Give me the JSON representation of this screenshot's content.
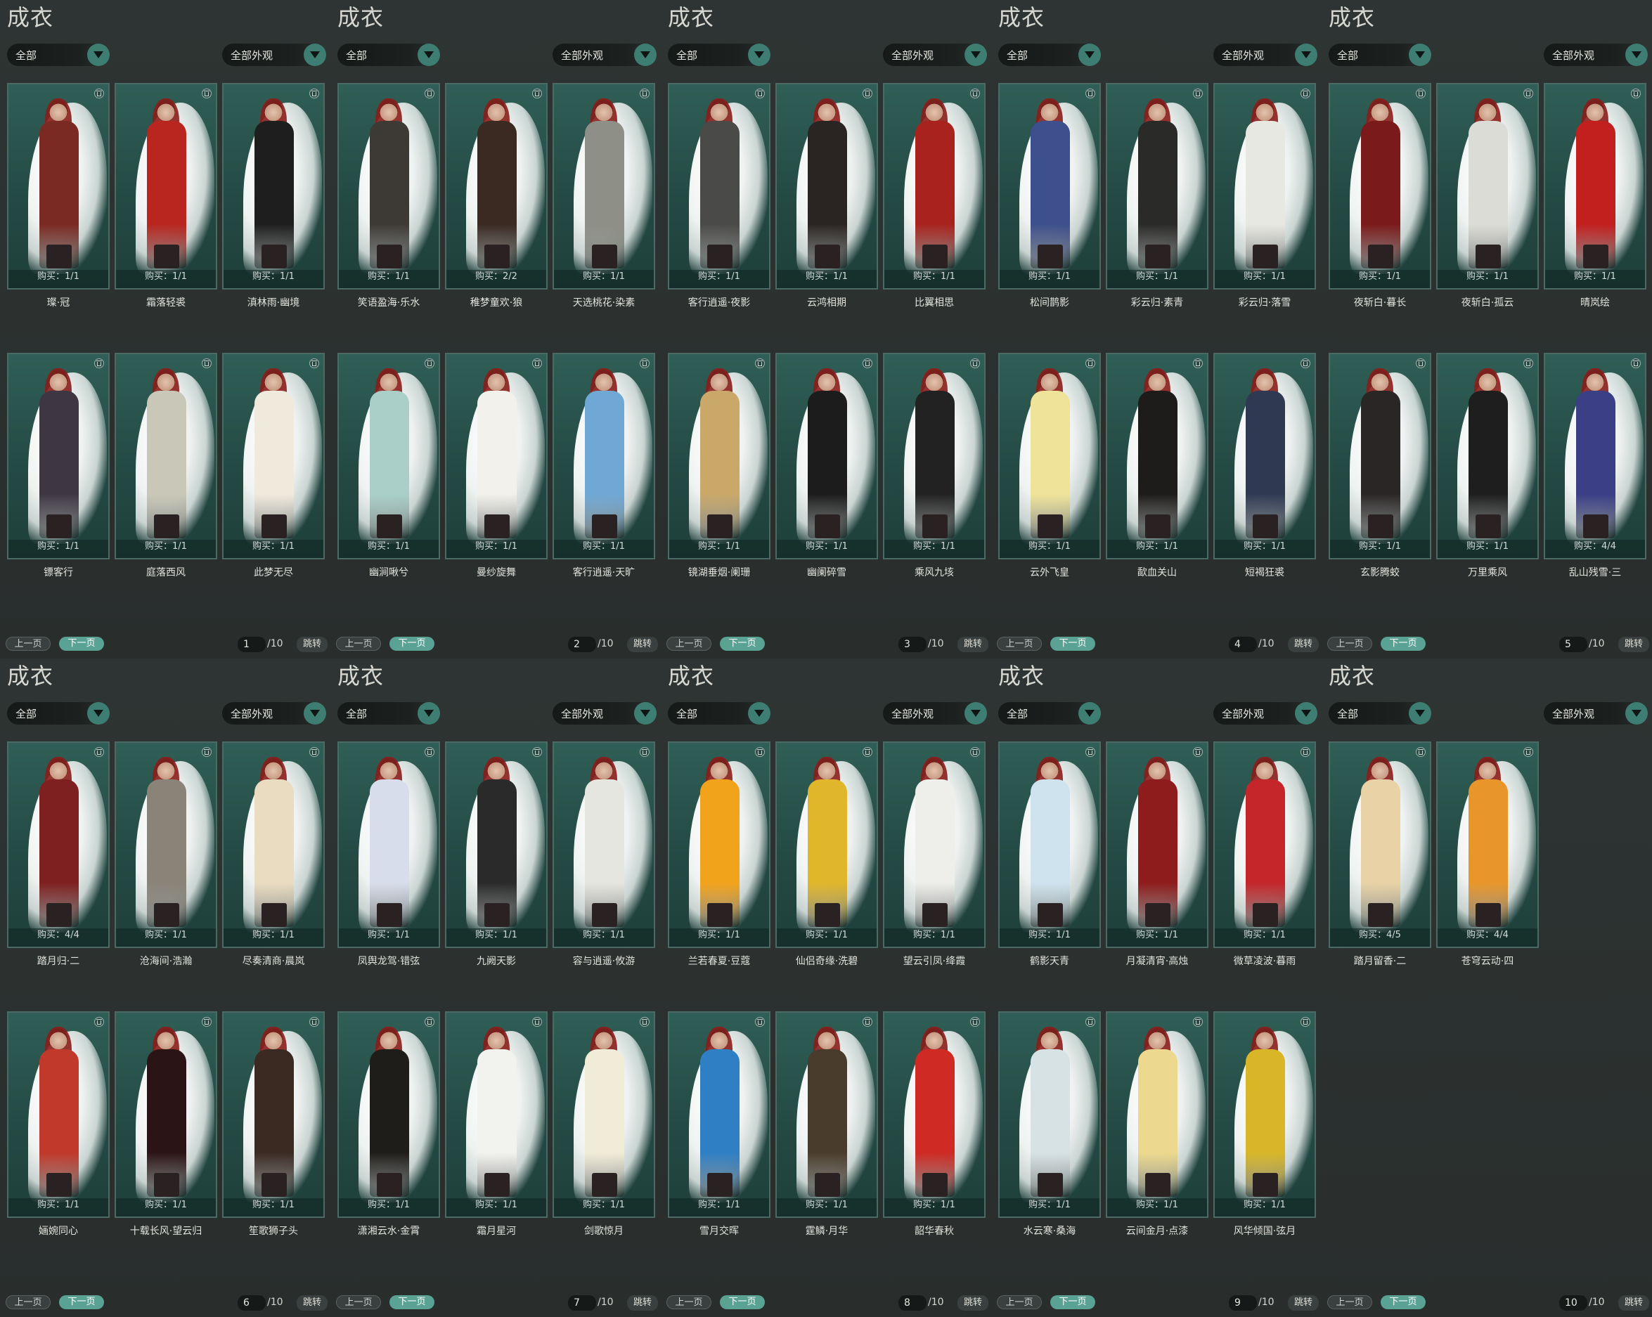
{
  "panels": [
    {
      "title": "成衣",
      "category": "全部",
      "look_filter": "全部外观",
      "page": "1",
      "total": "/10",
      "prev": "上一页",
      "next": "下一页",
      "jump": "跳转",
      "items": [
        {
          "name": "璨·冠",
          "buy": "购买：1/1",
          "outfit": "#7a2a22"
        },
        {
          "name": "霜落轻裘",
          "buy": "购买：1/1",
          "outfit": "#b8261f"
        },
        {
          "name": "滇林雨·幽境",
          "buy": "购买：1/1",
          "outfit": "#1e1e1e"
        },
        {
          "name": "镖客行",
          "buy": "购买：1/1",
          "outfit": "#3e3742"
        },
        {
          "name": "庭落西风",
          "buy": "购买：1/1",
          "outfit": "#c9c8b8"
        },
        {
          "name": "此梦无尽",
          "buy": "购买：1/1",
          "outfit": "#efeadc"
        }
      ]
    },
    {
      "title": "成衣",
      "category": "全部",
      "look_filter": "全部外观",
      "page": "2",
      "total": "/10",
      "prev": "上一页",
      "next": "下一页",
      "jump": "跳转",
      "items": [
        {
          "name": "笑语盈海·乐水",
          "buy": "购买：1/1",
          "outfit": "#3d3a36"
        },
        {
          "name": "稚梦童欢·狼",
          "buy": "购买：2/2",
          "outfit": "#3a2a22"
        },
        {
          "name": "天选桃花·染素",
          "buy": "购买：1/1",
          "outfit": "#8e8f86"
        },
        {
          "name": "幽涧啾兮",
          "buy": "购买：1/1",
          "outfit": "#a9cfc8"
        },
        {
          "name": "曼纱旋舞",
          "buy": "购买：1/1",
          "outfit": "#f2f1ec"
        },
        {
          "name": "客行逍遥·天旷",
          "buy": "购买：1/1",
          "outfit": "#6fa8d4"
        }
      ]
    },
    {
      "title": "成衣",
      "category": "全部",
      "look_filter": "全部外观",
      "page": "3",
      "total": "/10",
      "prev": "上一页",
      "next": "下一页",
      "jump": "跳转",
      "items": [
        {
          "name": "客行逍遥·夜影",
          "buy": "购买：1/1",
          "outfit": "#4a4a48"
        },
        {
          "name": "云鸿相期",
          "buy": "购买：1/1",
          "outfit": "#2a2522"
        },
        {
          "name": "比翼相思",
          "buy": "购买：1/1",
          "outfit": "#a8231e"
        },
        {
          "name": "镜湖垂烟·阑珊",
          "buy": "购买：1/1",
          "outfit": "#c9a86a"
        },
        {
          "name": "幽阑碎雪",
          "buy": "购买：1/1",
          "outfit": "#1c1c1c"
        },
        {
          "name": "乘风九垓",
          "buy": "购买：1/1",
          "outfit": "#222222"
        }
      ]
    },
    {
      "title": "成衣",
      "category": "全部",
      "look_filter": "全部外观",
      "page": "4",
      "total": "/10",
      "prev": "上一页",
      "next": "下一页",
      "jump": "跳转",
      "items": [
        {
          "name": "松间鹊影",
          "buy": "购买：1/1",
          "outfit": "#3d4f8c"
        },
        {
          "name": "彩云归·素青",
          "buy": "购买：1/1",
          "outfit": "#2a2a28"
        },
        {
          "name": "彩云归·落雪",
          "buy": "购买：1/1",
          "outfit": "#e8e8e2"
        },
        {
          "name": "云外飞皇",
          "buy": "购买：1/1",
          "outfit": "#efe39a"
        },
        {
          "name": "歃血关山",
          "buy": "购买：1/1",
          "outfit": "#1e1c1a"
        },
        {
          "name": "短褐狂裘",
          "buy": "购买：1/1",
          "outfit": "#2f3a52"
        }
      ]
    },
    {
      "title": "成衣",
      "category": "全部",
      "look_filter": "全部外观",
      "page": "5",
      "total": "/10",
      "prev": "上一页",
      "next": "下一页",
      "jump": "跳转",
      "items": [
        {
          "name": "夜斩白·暮长",
          "buy": "购买：1/1",
          "outfit": "#7a1a1a"
        },
        {
          "name": "夜斩白·孤云",
          "buy": "购买：1/1",
          "outfit": "#dcdcd6"
        },
        {
          "name": "晴岚绘",
          "buy": "购买：1/1",
          "outfit": "#c21f1f"
        },
        {
          "name": "玄影腾蛟",
          "buy": "购买：1/1",
          "outfit": "#2a2626"
        },
        {
          "name": "万里乘风",
          "buy": "购买：1/1",
          "outfit": "#1e1e1e"
        },
        {
          "name": "乱山残雪·三",
          "buy": "购买：4/4",
          "outfit": "#3a3f86"
        }
      ]
    },
    {
      "title": "成衣",
      "category": "全部",
      "look_filter": "全部外观",
      "page": "6",
      "total": "/10",
      "prev": "上一页",
      "next": "下一页",
      "jump": "跳转",
      "items": [
        {
          "name": "踏月归·二",
          "buy": "购买：4/4",
          "outfit": "#7e2020"
        },
        {
          "name": "沧海间·浩瀚",
          "buy": "购买：1/1",
          "outfit": "#8a8478"
        },
        {
          "name": "尽奏清商·晨岚",
          "buy": "购买：1/1",
          "outfit": "#e9dcc0"
        },
        {
          "name": "婳婉同心",
          "buy": "购买：1/1",
          "outfit": "#c0392b"
        },
        {
          "name": "十载长风·望云归",
          "buy": "购买：1/1",
          "outfit": "#2a1416"
        },
        {
          "name": "笙歌狮子头",
          "buy": "购买：1/1",
          "outfit": "#3a2a22"
        }
      ]
    },
    {
      "title": "成衣",
      "category": "全部",
      "look_filter": "全部外观",
      "page": "7",
      "total": "/10",
      "prev": "上一页",
      "next": "下一页",
      "jump": "跳转",
      "items": [
        {
          "name": "凤舆龙驾·错弦",
          "buy": "购买：1/1",
          "outfit": "#d7ddea"
        },
        {
          "name": "九阙天影",
          "buy": "购买：1/1",
          "outfit": "#2a2a2a"
        },
        {
          "name": "容与逍遥·攸游",
          "buy": "购买：1/1",
          "outfit": "#e6e6e0"
        },
        {
          "name": "潇湘云水·金霄",
          "buy": "购买：1/1",
          "outfit": "#1f1d1a"
        },
        {
          "name": "霜月星河",
          "buy": "购买：1/1",
          "outfit": "#f2f2ee"
        },
        {
          "name": "剑歌惊月",
          "buy": "购买：1/1",
          "outfit": "#f1ecd8"
        }
      ]
    },
    {
      "title": "成衣",
      "category": "全部",
      "look_filter": "全部外观",
      "page": "8",
      "total": "/10",
      "prev": "上一页",
      "next": "下一页",
      "jump": "跳转",
      "items": [
        {
          "name": "兰若春夏·豆蔻",
          "buy": "购买：1/1",
          "outfit": "#f2a31c"
        },
        {
          "name": "仙侣奇缘·洗碧",
          "buy": "购买：1/1",
          "outfit": "#e0b62a"
        },
        {
          "name": "望云引凤·绛霞",
          "buy": "购买：1/1",
          "outfit": "#eeeeea"
        },
        {
          "name": "雪月交晖",
          "buy": "购买：1/1",
          "outfit": "#2f7fc4"
        },
        {
          "name": "霆鳞·月华",
          "buy": "购买：1/1",
          "outfit": "#4a3c2c"
        },
        {
          "name": "韶华春秋",
          "buy": "购买：1/1",
          "outfit": "#cf2a24"
        }
      ]
    },
    {
      "title": "成衣",
      "category": "全部",
      "look_filter": "全部外观",
      "page": "9",
      "total": "/10",
      "prev": "上一页",
      "next": "下一页",
      "jump": "跳转",
      "items": [
        {
          "name": "鹤影天青",
          "buy": "购买：1/1",
          "outfit": "#cfe3ee"
        },
        {
          "name": "月凝清宵·高烛",
          "buy": "购买：1/1",
          "outfit": "#8e1c1c"
        },
        {
          "name": "微草凌波·暮雨",
          "buy": "购买：1/1",
          "outfit": "#c4262a"
        },
        {
          "name": "水云寒·桑海",
          "buy": "购买：1/1",
          "outfit": "#d6e2e4"
        },
        {
          "name": "云间金月·点漆",
          "buy": "购买：1/1",
          "outfit": "#ecd98e"
        },
        {
          "name": "风华倾国·弦月",
          "buy": "购买：1/1",
          "outfit": "#d8b628"
        }
      ]
    },
    {
      "title": "成衣",
      "category": "全部",
      "look_filter": "全部外观",
      "page": "10",
      "total": "/10",
      "prev": "上一页",
      "next": "下一页",
      "jump": "跳转",
      "items": [
        {
          "name": "踏月留香·二",
          "buy": "购买：4/5",
          "outfit": "#e8d2a6"
        },
        {
          "name": "苍穹云动·四",
          "buy": "购买：4/4",
          "outfit": "#e8962a"
        }
      ]
    }
  ]
}
